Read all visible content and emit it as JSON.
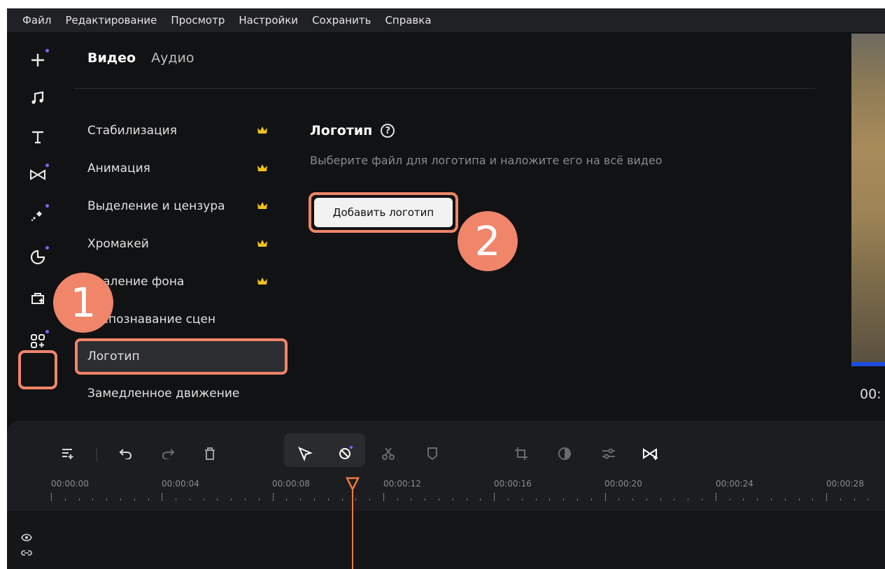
{
  "menu": [
    "Файл",
    "Редактирование",
    "Просмотр",
    "Настройки",
    "Сохранить",
    "Справка"
  ],
  "sidebar_icons": [
    "add-media-icon",
    "music-icon",
    "text-icon",
    "transitions-icon",
    "effects-icon",
    "stickers-icon",
    "callouts-icon",
    "more-tools-icon"
  ],
  "tabs": {
    "video": "Видео",
    "audio": "Аудио"
  },
  "effects": [
    {
      "label": "Стабилизация",
      "premium": true
    },
    {
      "label": "Анимация",
      "premium": true
    },
    {
      "label": "Выделение и цензура",
      "premium": true
    },
    {
      "label": "Хромакей",
      "premium": true
    },
    {
      "label": "Удаление фона",
      "premium": true
    },
    {
      "label": "Распознавание сцен",
      "premium": false
    },
    {
      "label": "Логотип",
      "premium": false,
      "selected": true
    },
    {
      "label": "Замедленное движение",
      "premium": false
    }
  ],
  "detail": {
    "title": "Логотип",
    "help": "?",
    "description": "Выберите файл для логотипа и наложите его на всё видео",
    "button": "Добавить логотип"
  },
  "badges": {
    "one": "1",
    "two": "2"
  },
  "preview": {
    "time": "00:"
  },
  "ruler": [
    "00:00:00",
    "00:00:04",
    "00:00:08",
    "00:00:12",
    "00:00:16",
    "00:00:20",
    "00:00:24",
    "00:00:28"
  ],
  "colors": {
    "accent": "#f0856a",
    "playhead": "#f07a3a",
    "crown": "#f2c21b",
    "dot": "#8a5cf5"
  }
}
